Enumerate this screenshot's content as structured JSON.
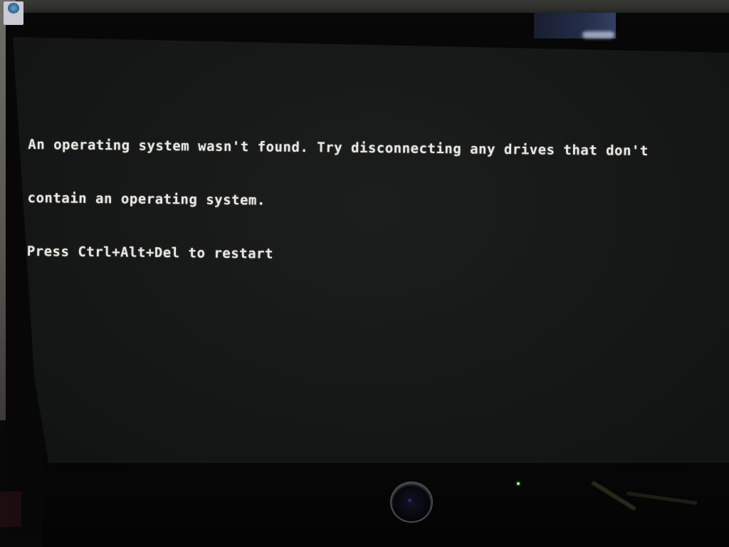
{
  "screen": {
    "message_lines": [
      "An operating system wasn't found. Try disconnecting any drives that don't",
      "contain an operating system.",
      "Press Ctrl+Alt+Del to restart"
    ]
  },
  "colors": {
    "screen_background": "#161818",
    "text": "#e9e7e1",
    "status_led": "#a8f080"
  }
}
